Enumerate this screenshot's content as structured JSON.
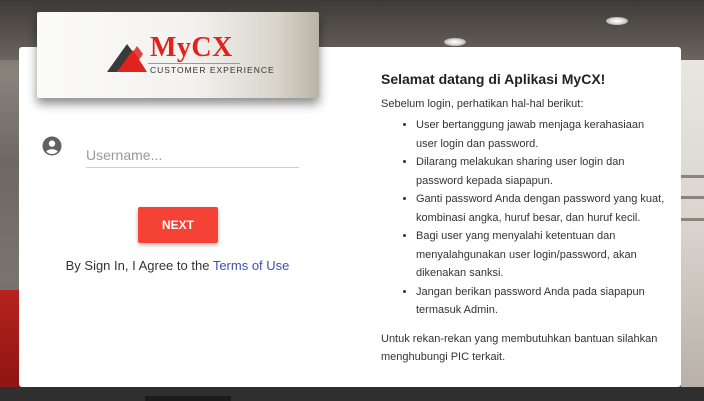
{
  "logo": {
    "brand": "MyCX",
    "tagline": "CUSTOMER EXPERIENCE",
    "colors": {
      "red": "#e0231c",
      "dark": "#333333"
    }
  },
  "login": {
    "username_placeholder": "Username...",
    "username_value": "",
    "next_label": "NEXT",
    "terms_prefix": "By Sign In, I Agree to the ",
    "terms_link": "Terms of Use",
    "button_color": "#f44336",
    "link_color": "#3f51b5"
  },
  "info": {
    "title": "Selamat datang di Aplikasi MyCX!",
    "intro": "Sebelum login, perhatikan hal-hal berikut:",
    "items": [
      "User bertanggung jawab menjaga kerahasiaan user login dan password.",
      "Dilarang melakukan sharing user login dan password kepada siapapun.",
      "Ganti password Anda dengan password yang kuat, kombinasi angka, huruf besar, dan huruf kecil.",
      "Bagi user yang menyalahi ketentuan dan menyalahgunakan user login/password, akan dikenakan sanksi.",
      "Jangan berikan password Anda pada siapapun termasuk Admin."
    ],
    "outro": "Untuk rekan-rekan yang membutuhkan bantuan silahkan menghubungi PIC terkait."
  },
  "icons": {
    "user": "account-circle-icon"
  }
}
